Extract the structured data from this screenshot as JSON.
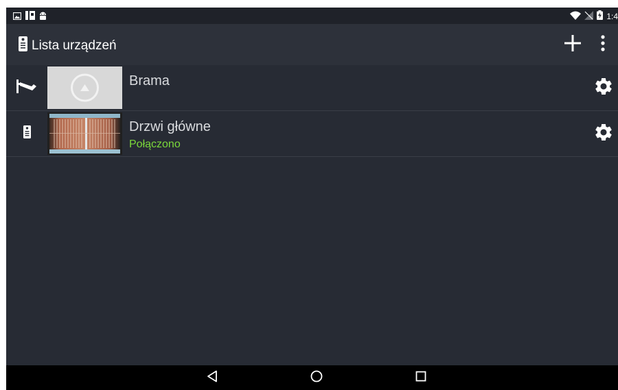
{
  "status_bar": {
    "time": "1:4",
    "icons": [
      "image-icon",
      "sim-card-icon",
      "android-icon",
      "wifi-icon",
      "no-signal-icon",
      "battery-charging-icon"
    ]
  },
  "app_bar": {
    "title": "Lista urządzeń",
    "title_icon": "intercom-icon",
    "actions": [
      "add-icon",
      "overflow-menu-icon"
    ]
  },
  "devices": [
    {
      "name": "Brama",
      "status": "",
      "type_icon": "camera-icon",
      "thumbnail": "placeholder-image"
    },
    {
      "name": "Drzwi główne",
      "status": "Połączono",
      "type_icon": "intercom-icon",
      "thumbnail": "camera-preview"
    }
  ],
  "colors": {
    "background": "#272b34",
    "app_bar": "#2d313a",
    "status_connected": "#7bd93b",
    "nav_bar": "#000000"
  },
  "nav_bar": {
    "buttons": [
      "back-icon",
      "home-icon",
      "recents-icon"
    ]
  }
}
